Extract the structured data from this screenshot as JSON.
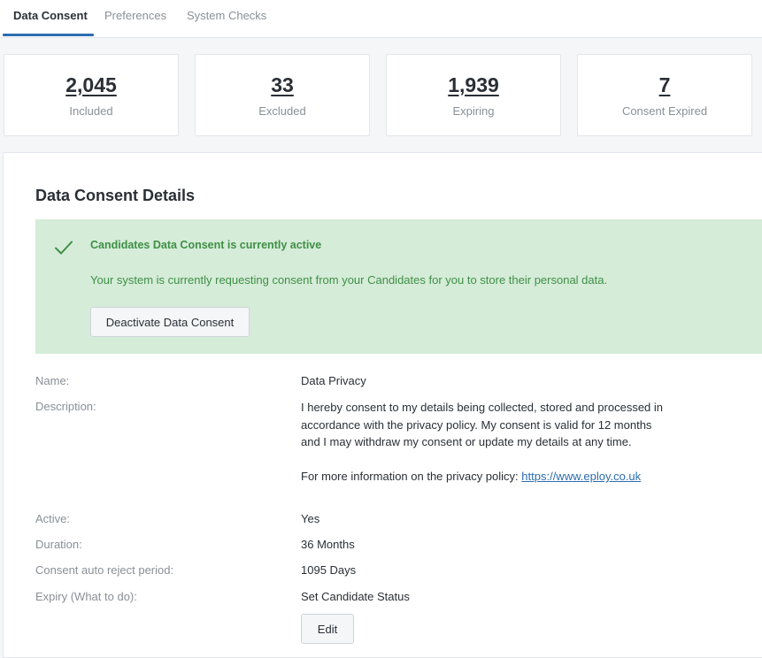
{
  "tabs": [
    {
      "label": "Data Consent",
      "active": true
    },
    {
      "label": "Preferences",
      "active": false
    },
    {
      "label": "System Checks",
      "active": false
    }
  ],
  "stats": [
    {
      "value": "2,045",
      "label": "Included"
    },
    {
      "value": "33",
      "label": "Excluded"
    },
    {
      "value": "1,939",
      "label": "Expiring"
    },
    {
      "value": "7",
      "label": "Consent Expired"
    }
  ],
  "section": {
    "title": "Data Consent Details"
  },
  "banner": {
    "icon": "check-icon",
    "title": "Candidates Data Consent is currently active",
    "text": "Your system is currently requesting consent from your Candidates for you to store their personal data.",
    "button_label": "Deactivate Data Consent",
    "background": "#d5ecd8",
    "text_color": "#3f8f46"
  },
  "details": {
    "name": {
      "label": "Name:",
      "value": "Data Privacy"
    },
    "description": {
      "label": "Description:",
      "text": "I hereby consent to my details being collected, stored and processed in accordance with the privacy policy. My consent is valid for 12 months and I may withdraw my consent or update my details at any time.",
      "more_info": "For more information on the privacy policy: ",
      "link": "https://www.eploy.co.uk"
    },
    "active": {
      "label": "Active:",
      "value": "Yes"
    },
    "duration": {
      "label": "Duration:",
      "value": "36 Months"
    },
    "auto_reject": {
      "label": "Consent auto reject period:",
      "value": "1095 Days"
    },
    "expiry": {
      "label": "Expiry (What to do):",
      "value": "Set Candidate Status"
    }
  },
  "edit_label": "Edit",
  "colors": {
    "accent": "#2b6cb0",
    "success": "#3f8f46"
  }
}
